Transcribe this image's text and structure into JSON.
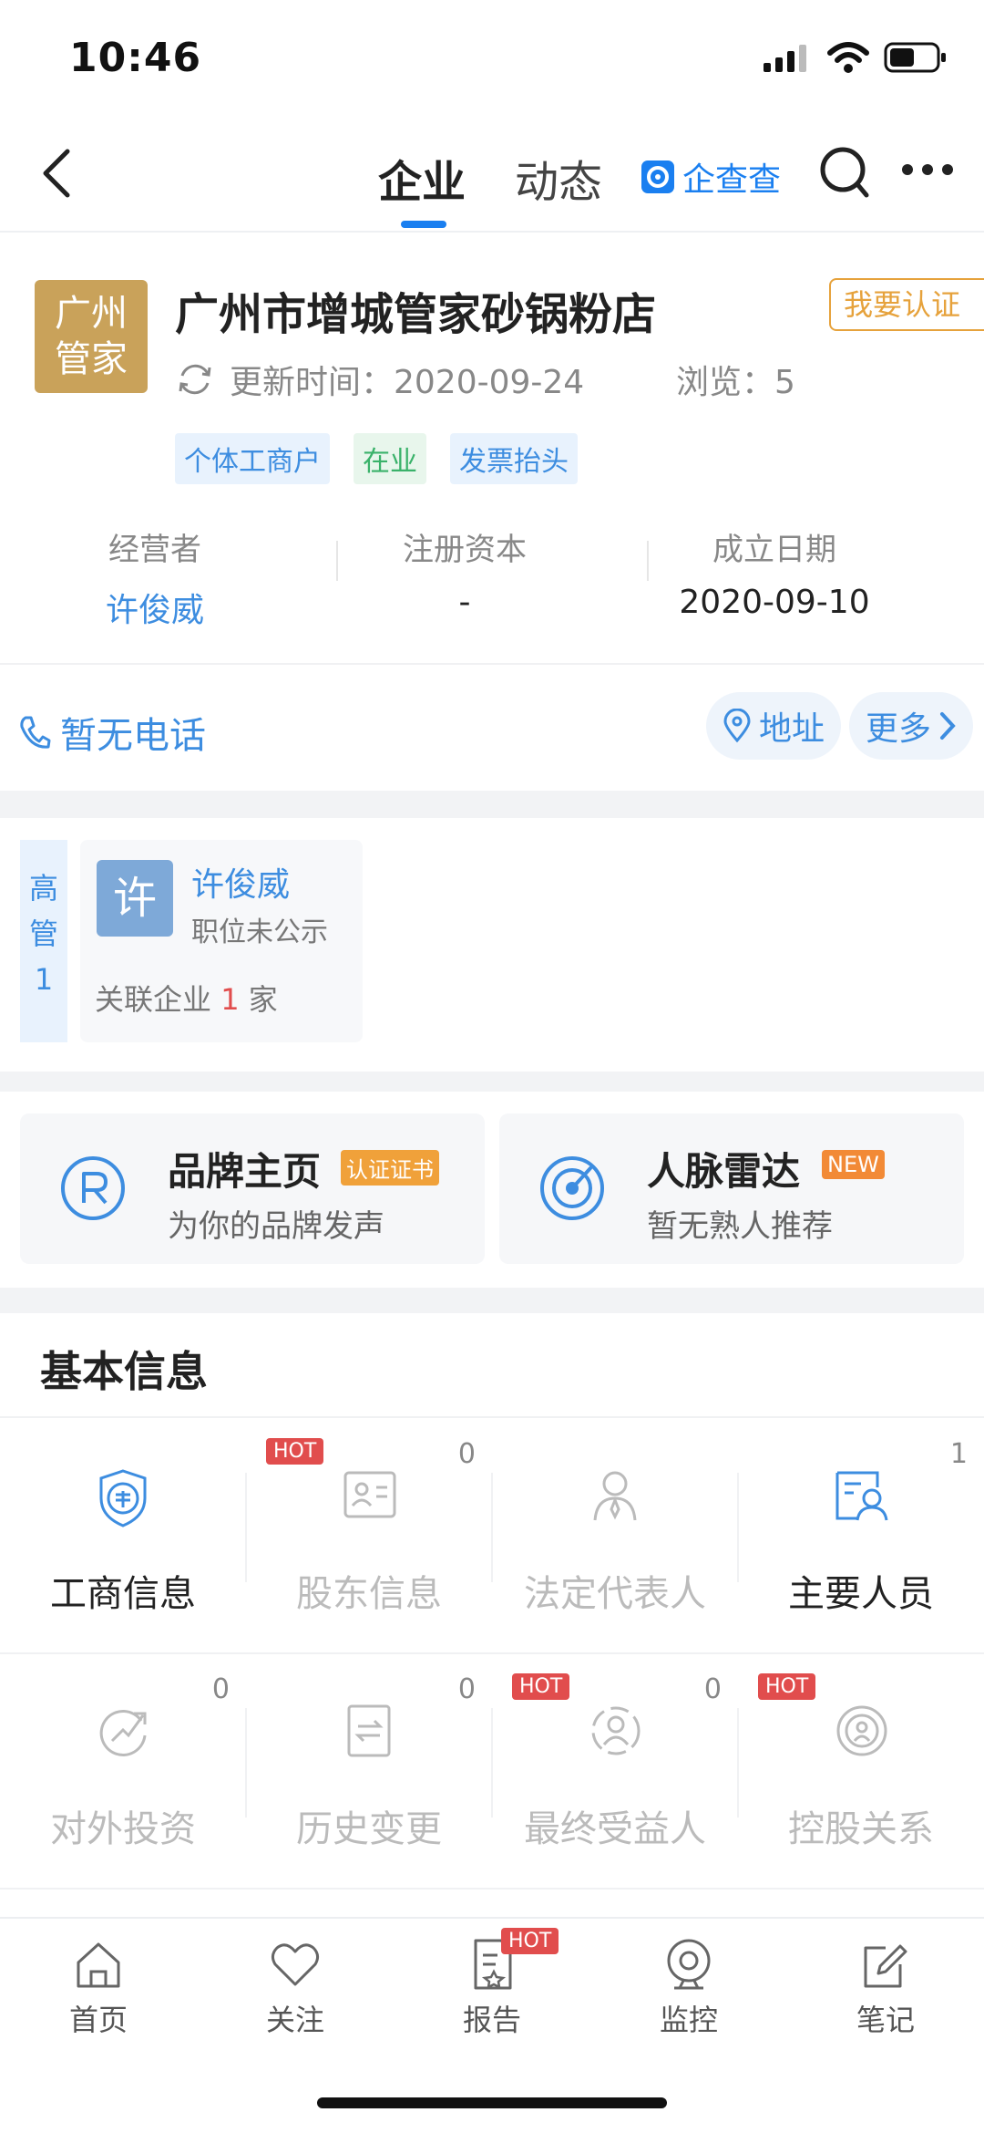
{
  "status": {
    "time": "10:46"
  },
  "nav": {
    "tab_company": "企业",
    "tab_news": "动态",
    "brand": "企查查"
  },
  "company": {
    "logo_line1": "广州",
    "logo_line2": "管家",
    "name": "广州市增城管家砂锅粉店",
    "verify": "我要认证",
    "update_label": "更新时间：2020-09-24",
    "views": "浏览：5",
    "tags": [
      "个体工商户",
      "在业",
      "发票抬头"
    ],
    "stats": [
      {
        "label": "经营者",
        "value": "许俊威"
      },
      {
        "label": "注册资本",
        "value": "-"
      },
      {
        "label": "成立日期",
        "value": "2020-09-10"
      }
    ]
  },
  "contact": {
    "phone": "暂无电话",
    "address": "地址",
    "more": "更多"
  },
  "exec": {
    "side": [
      "高",
      "管",
      "1"
    ],
    "avatar": "许",
    "name": "许俊威",
    "position": "职位未公示",
    "related_prefix": "关联企业",
    "related_count": "1",
    "related_suffix": "家"
  },
  "promo": [
    {
      "title": "品牌主页",
      "badge": "认证证书",
      "sub": "为你的品牌发声",
      "icon": "brand-icon"
    },
    {
      "title": "人脉雷达",
      "badge": "NEW",
      "sub": "暂无熟人推荐",
      "icon": "radar-icon"
    }
  ],
  "basic": {
    "title": "基本信息",
    "items": [
      {
        "label": "工商信息",
        "count": "",
        "hot": ""
      },
      {
        "label": "股东信息",
        "count": "0",
        "hot": "HOT"
      },
      {
        "label": "法定代表人",
        "count": "",
        "hot": ""
      },
      {
        "label": "主要人员",
        "count": "1",
        "hot": ""
      },
      {
        "label": "对外投资",
        "count": "0",
        "hot": ""
      },
      {
        "label": "历史变更",
        "count": "0",
        "hot": ""
      },
      {
        "label": "最终受益人",
        "count": "0",
        "hot": "HOT"
      },
      {
        "label": "控股关系",
        "count": "",
        "hot": "HOT"
      }
    ]
  },
  "tabbar": {
    "items": [
      "首页",
      "关注",
      "报告",
      "监控",
      "笔记"
    ],
    "report_badge": "HOT"
  }
}
